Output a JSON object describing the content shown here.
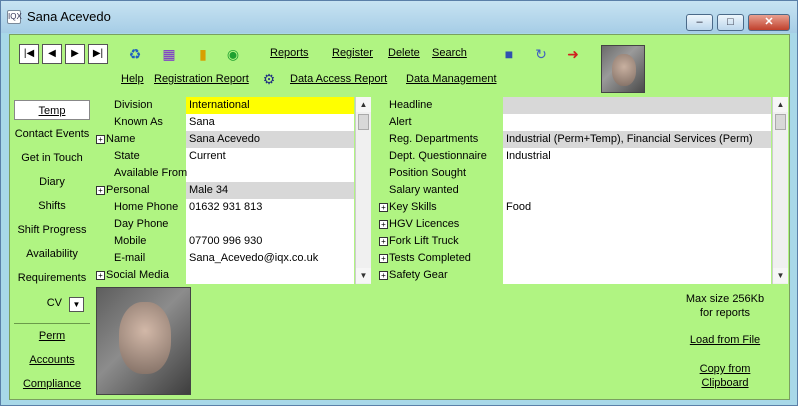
{
  "window": {
    "title": "Sana Acevedo",
    "icon_text": "IQX"
  },
  "toolbar": {
    "links_row1": [
      "Reports",
      "Register",
      "Delete",
      "Search"
    ],
    "links_row2": [
      "Help",
      "Registration Report",
      "Data Access Report",
      "Data Management"
    ]
  },
  "sidebar": {
    "items": [
      "Temp",
      "Contact Events",
      "Get in Touch",
      "Diary",
      "Shifts",
      "Shift Progress",
      "Availability",
      "Requirements"
    ],
    "cv_label": "CV",
    "bottom_items": [
      "Perm",
      "Accounts",
      "Compliance"
    ]
  },
  "grid_left": [
    {
      "label": "Division",
      "value": "International",
      "hl": "yellow"
    },
    {
      "label": "Known As",
      "value": "Sana"
    },
    {
      "label": "Name",
      "value": "Sana Acevedo",
      "expand": true,
      "hl": "grey"
    },
    {
      "label": "State",
      "value": "Current"
    },
    {
      "label": "Available From",
      "value": ""
    },
    {
      "label": "Personal",
      "value": "Male 34",
      "expand": true,
      "hl": "grey"
    },
    {
      "label": "Home Phone",
      "value": "01632 931 813"
    },
    {
      "label": "Day Phone",
      "value": ""
    },
    {
      "label": "Mobile",
      "value": "07700 996 930"
    },
    {
      "label": "E-mail",
      "value": "Sana_Acevedo@iqx.co.uk"
    },
    {
      "label": "Social Media",
      "value": "",
      "expand": true
    }
  ],
  "grid_right": [
    {
      "label": "Headline",
      "value": "",
      "hl": "grey"
    },
    {
      "label": "Alert",
      "value": ""
    },
    {
      "label": "Reg. Departments",
      "value": "Industrial (Perm+Temp), Financial Services (Perm)",
      "hl": "grey"
    },
    {
      "label": "Dept. Questionnaire",
      "value": "Industrial"
    },
    {
      "label": "Position Sought",
      "value": ""
    },
    {
      "label": "Salary wanted",
      "value": ""
    },
    {
      "label": "Key Skills",
      "value": "Food",
      "expand": true
    },
    {
      "label": "HGV Licences",
      "value": "",
      "expand": true
    },
    {
      "label": "Fork Lift Truck",
      "value": "",
      "expand": true
    },
    {
      "label": "Tests Completed",
      "value": "",
      "expand": true
    },
    {
      "label": "Safety Gear",
      "value": "",
      "expand": true
    }
  ],
  "photo_panel": {
    "max_size_line1": "Max size 256Kb",
    "max_size_line2": "for reports",
    "load_link": "Load from File",
    "copy_line1": "Copy from",
    "copy_line2": "Clipboard"
  }
}
